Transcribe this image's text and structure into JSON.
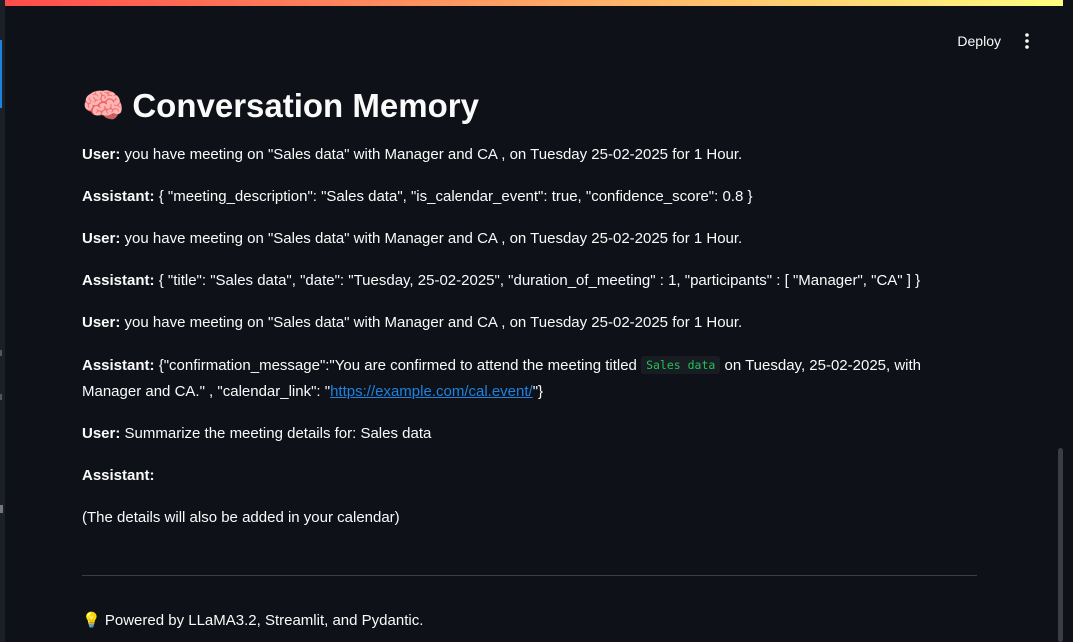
{
  "header": {
    "deploy_label": "Deploy",
    "menu_icon": "kebab-vertical-icon"
  },
  "page": {
    "title_emoji": "🧠",
    "title": "Conversation Memory"
  },
  "messages": [
    {
      "role": "User:",
      "text": " you have meeting on \"Sales data\" with Manager and CA , on Tuesday 25-02-2025 for 1 Hour."
    },
    {
      "role": "Assistant:",
      "text": " { \"meeting_description\": \"Sales data\", \"is_calendar_event\": true, \"confidence_score\": 0.8 }"
    },
    {
      "role": "User:",
      "text": " you have meeting on \"Sales data\" with Manager and CA , on Tuesday 25-02-2025 for 1 Hour."
    },
    {
      "role": "Assistant:",
      "text": " { \"title\": \"Sales data\", \"date\": \"Tuesday, 25-02-2025\", \"duration_of_meeting\" : 1, \"participants\" : [ \"Manager\", \"CA\" ] }"
    },
    {
      "role": "User:",
      "text": " you have meeting on \"Sales data\" with Manager and CA , on Tuesday 25-02-2025 for 1 Hour."
    },
    {
      "role": "Assistant:",
      "text_before": " {\"confirmation_message\":\"You are confirmed to attend the meeting titled ",
      "code": "Sales data",
      "text_after": " on Tuesday, 25-02-2025, with Manager and CA.\" , \"calendar_link\": \"",
      "link": "https://example.com/cal.event/",
      "text_end": "\"}"
    },
    {
      "role": "User:",
      "text": " Summarize the meeting details for: Sales data"
    },
    {
      "role": "Assistant:",
      "text": ""
    },
    {
      "text": "(The details will also be added in your calendar)"
    }
  ],
  "footer": {
    "emoji": "💡",
    "text": " Powered by LLaMA3.2, Streamlit, and Pydantic."
  },
  "colors": {
    "background": "#0e1117",
    "text": "#fafafa",
    "link": "#1c83e1",
    "code": "#21c354"
  }
}
